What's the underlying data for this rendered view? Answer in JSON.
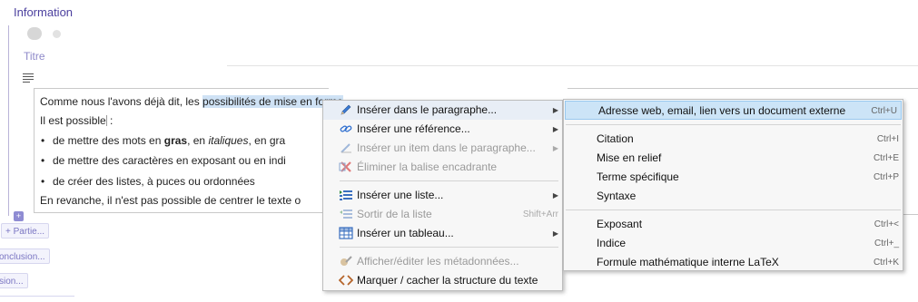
{
  "header": {
    "section_title": "Information",
    "titre_label": "Titre"
  },
  "document": {
    "line1_before": "Comme nous l'avons déjà dit, les ",
    "line1_selected": "possibilités de mise en forme",
    "line2_a": "Il est possible",
    "line2_b": " :",
    "bullet1_a": "de mettre des mots en ",
    "bullet1_bold": "gras",
    "bullet1_b": ", en ",
    "bullet1_italic": "italiques",
    "bullet1_c": ", en gra",
    "bullet2": "de mettre des caractères en exposant ou en indi",
    "bullet3": "de créer des listes, à puces ou ordonnées",
    "line_last": "En revanche, il n'est pas possible de centrer le texte o"
  },
  "outline": {
    "add_symbol": "+",
    "partie": "+ Partie...",
    "conclusion": "onclusion...",
    "sion": "sion..."
  },
  "context_menu": {
    "items": [
      {
        "label": "Insérer dans le paragraphe...",
        "icon": "pencil-icon",
        "submenu": true,
        "disabled": false,
        "active": true
      },
      {
        "label": "Insérer une référence...",
        "icon": "link-icon",
        "submenu": true,
        "disabled": false
      },
      {
        "label": "Insérer un item dans le paragraphe...",
        "icon": "item-icon",
        "submenu": true,
        "disabled": true
      },
      {
        "label": "Éliminer la balise encadrante",
        "icon": "remove-tag-icon",
        "disabled": true
      },
      {
        "label": "Insérer une liste...",
        "icon": "list-icon",
        "submenu": true,
        "disabled": false
      },
      {
        "label": "Sortir de la liste",
        "icon": "outdent-icon",
        "shortcut": "Shift+Arr",
        "disabled": true
      },
      {
        "label": "Insérer un tableau...",
        "icon": "table-icon",
        "submenu": true,
        "disabled": false
      },
      {
        "label": "Afficher/éditer les métadonnées...",
        "icon": "metadata-icon",
        "disabled": true
      },
      {
        "label": "Marquer / cacher la structure du texte",
        "icon": "code-icon",
        "disabled": false
      }
    ]
  },
  "submenu": {
    "items": [
      {
        "label": "Adresse web, email, lien vers un document externe",
        "shortcut": "Ctrl+U",
        "highlighted": true
      },
      {
        "label": "Citation",
        "shortcut": "Ctrl+I"
      },
      {
        "label": "Mise en relief",
        "shortcut": "Ctrl+E"
      },
      {
        "label": "Terme spécifique",
        "shortcut": "Ctrl+P"
      },
      {
        "label": "Syntaxe",
        "shortcut": ""
      },
      {
        "label": "Exposant",
        "shortcut": "Ctrl+<"
      },
      {
        "label": "Indice",
        "shortcut": "Ctrl+_"
      },
      {
        "label": "Formule mathématique interne LaTeX",
        "shortcut": "Ctrl+K"
      }
    ]
  },
  "colors": {
    "accent": "#4b3f9e",
    "highlight": "#cce4f7",
    "selection": "#cfe2f5"
  }
}
